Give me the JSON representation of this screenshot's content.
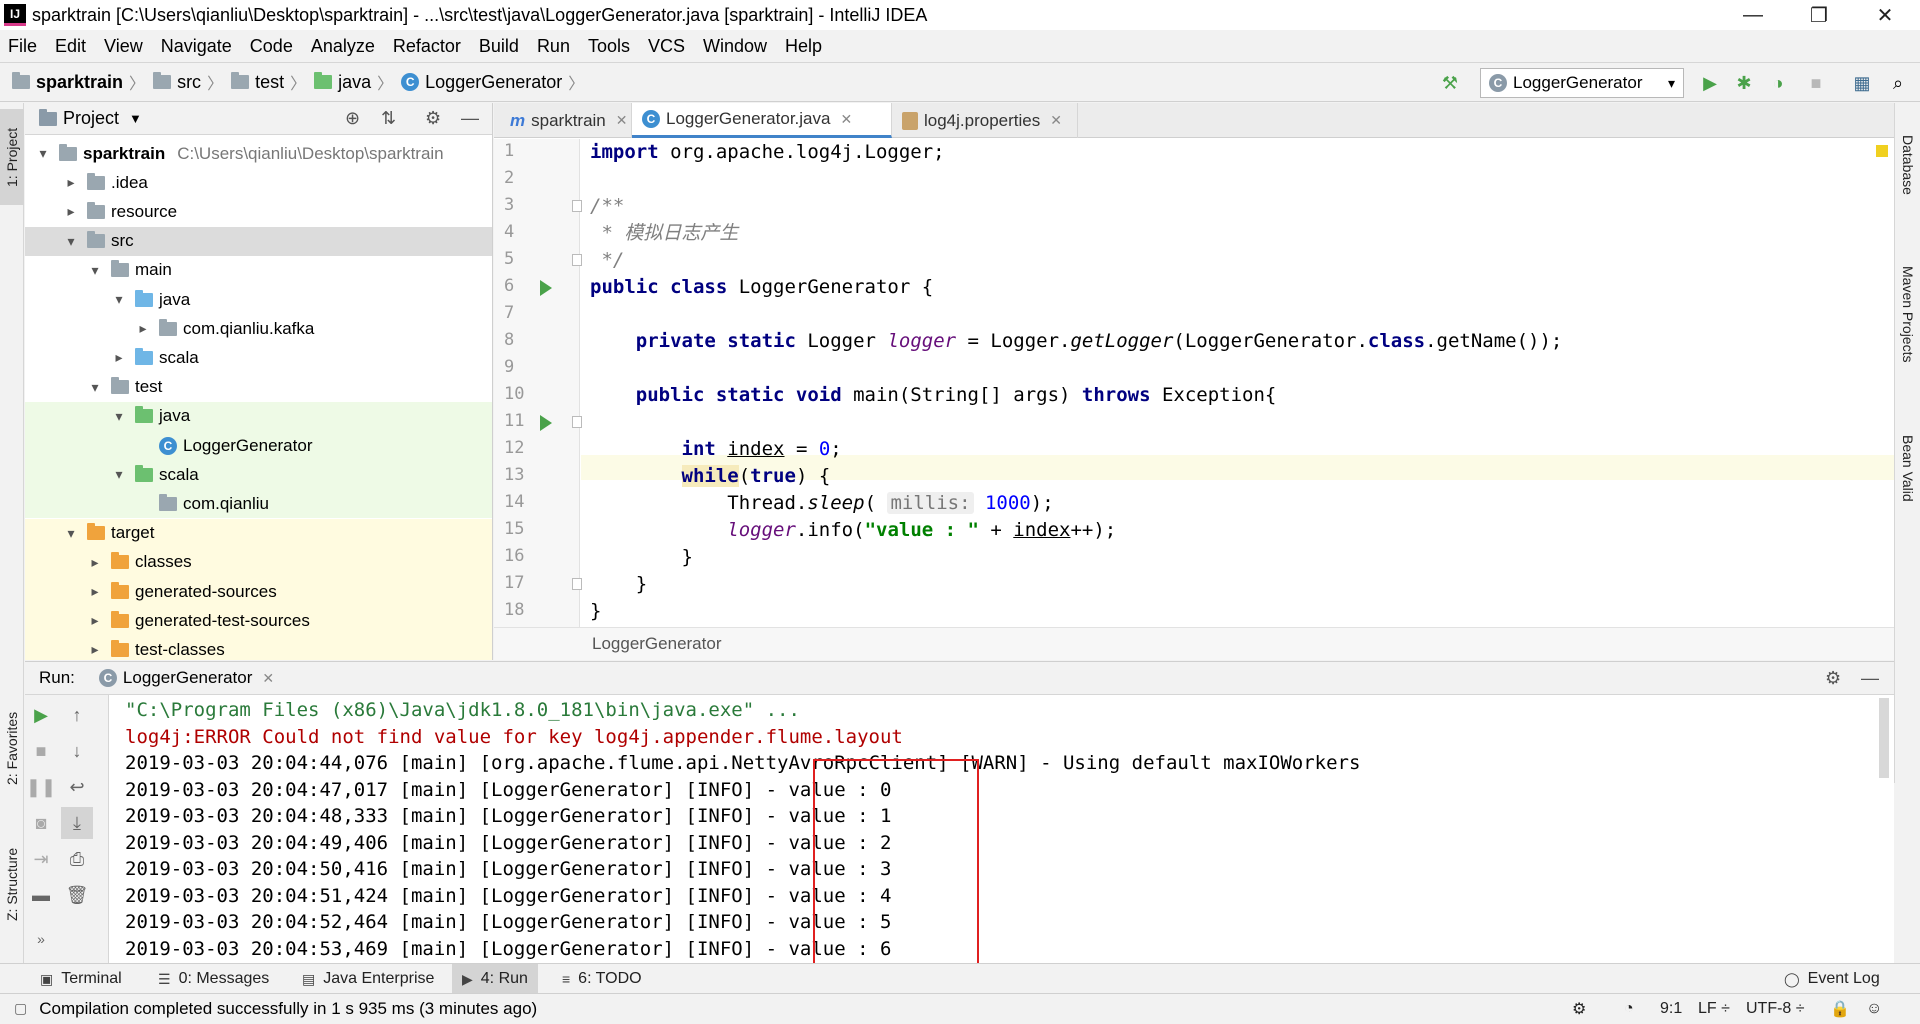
{
  "window": {
    "title": "sparktrain [C:\\Users\\qianliu\\Desktop\\sparktrain] - ...\\src\\test\\java\\LoggerGenerator.java [sparktrain] - IntelliJ IDEA",
    "minimize": "—",
    "maximize": "❐",
    "close": "✕"
  },
  "menu": [
    "File",
    "Edit",
    "View",
    "Navigate",
    "Code",
    "Analyze",
    "Refactor",
    "Build",
    "Run",
    "Tools",
    "VCS",
    "Window",
    "Help"
  ],
  "breadcrumb": [
    "sparktrain",
    "src",
    "test",
    "java",
    "LoggerGenerator"
  ],
  "toolbar": {
    "run_config": "LoggerGenerator",
    "icons": [
      "build-hammer-icon",
      "run-icon",
      "debug-icon",
      "coverage-icon",
      "stop-icon",
      "project-structure-icon",
      "search-icon"
    ]
  },
  "left_strip": {
    "project": "1: Project",
    "favorites": "2: Favorites",
    "structure": "Z: Structure"
  },
  "right_strip": {
    "database": "Database",
    "maven": "Maven Projects",
    "bean": "Bean Valid"
  },
  "project_panel": {
    "title": "Project",
    "tree": [
      {
        "label": "sparktrain",
        "path": "C:\\Users\\qianliu\\Desktop\\sparktrain",
        "arrow": "▾",
        "icon": "module",
        "bold": true
      },
      {
        "label": ".idea",
        "arrow": "▸",
        "icon": "folder"
      },
      {
        "label": "resource",
        "arrow": "▸",
        "icon": "folder"
      },
      {
        "label": "src",
        "arrow": "▾",
        "icon": "folder"
      },
      {
        "label": "main",
        "arrow": "▾",
        "icon": "folder"
      },
      {
        "label": "java",
        "arrow": "▾",
        "icon": "source-folder"
      },
      {
        "label": "com.qianliu.kafka",
        "arrow": "▸",
        "icon": "package"
      },
      {
        "label": "scala",
        "arrow": "▸",
        "icon": "source-folder"
      },
      {
        "label": "test",
        "arrow": "▾",
        "icon": "folder"
      },
      {
        "label": "java",
        "arrow": "▾",
        "icon": "test-folder"
      },
      {
        "label": "LoggerGenerator",
        "arrow": "",
        "icon": "class"
      },
      {
        "label": "scala",
        "arrow": "▾",
        "icon": "test-folder"
      },
      {
        "label": "com.qianliu",
        "arrow": "",
        "icon": "package"
      },
      {
        "label": "target",
        "arrow": "▾",
        "icon": "excluded-folder"
      },
      {
        "label": "classes",
        "arrow": "▸",
        "icon": "excluded-folder"
      },
      {
        "label": "generated-sources",
        "arrow": "▸",
        "icon": "excluded-folder"
      },
      {
        "label": "generated-test-sources",
        "arrow": "▸",
        "icon": "excluded-folder"
      },
      {
        "label": "test-classes",
        "arrow": "▸",
        "icon": "excluded-folder"
      }
    ]
  },
  "editor": {
    "tabs": [
      {
        "label": "sparktrain",
        "icon": "maven-icon"
      },
      {
        "label": "LoggerGenerator.java",
        "icon": "class-icon",
        "active": true
      },
      {
        "label": "log4j.properties",
        "icon": "properties-icon"
      }
    ],
    "line_numbers": [
      "1",
      "2",
      "3",
      "4",
      "5",
      "6",
      "7",
      "8",
      "9",
      "10",
      "11",
      "12",
      "13",
      "14",
      "15",
      "16",
      "17",
      "18"
    ],
    "code": {
      "l1_kw": "import",
      "l1_rest": " org.apache.log4j.Logger;",
      "l3": "/**",
      "l4": " * 模拟日志产生",
      "l5": " */",
      "l6_kw": "public class",
      "l6_rest": " LoggerGenerator {",
      "l8_kw": "private static",
      "l8_a": " Logger ",
      "l8_field": "logger",
      "l8_b": " = Logger.",
      "l8_method": "getLogger",
      "l8_c": "(LoggerGenerator.",
      "l8_kw2": "class",
      "l8_d": ".getName());",
      "l10_kw": "public static void",
      "l10_a": " main(String[] args) ",
      "l10_kw2": "throws",
      "l10_b": " Exception{",
      "l12_kw": "int",
      "l12_var": "index",
      "l12_a": " = ",
      "l12_num": "0",
      "l12_b": ";",
      "l13_kw": "while",
      "l13_a": "(",
      "l13_kw2": "true",
      "l13_b": ") {",
      "l14_a": "Thread.",
      "l14_method": "sleep",
      "l14_b": "( ",
      "l14_hint": "millis:",
      "l14_num": "1000",
      "l14_c": ");",
      "l15_field": "logger",
      "l15_a": ".info(",
      "l15_str": "\"value : \"",
      "l15_b": " + ",
      "l15_var": "index",
      "l15_c": "++);",
      "l16": "}",
      "l17": "}",
      "l18": "}"
    },
    "footer": "LoggerGenerator"
  },
  "run_panel": {
    "label": "Run:",
    "tab": "LoggerGenerator",
    "console": [
      {
        "text": "\"C:\\Program Files (x86)\\Java\\jdk1.8.0_181\\bin\\java.exe\" ...",
        "kind": "cmd"
      },
      {
        "text": "log4j:ERROR Could not find value for key log4j.appender.flume.layout",
        "kind": "err"
      },
      {
        "text": "2019-03-03 20:04:44,076 [main] [org.apache.flume.api.NettyAvroRpcClient] [WARN] - Using default maxIOWorkers",
        "kind": "out"
      },
      {
        "text": "2019-03-03 20:04:47,017 [main] [LoggerGenerator] [INFO] - value : 0",
        "kind": "out"
      },
      {
        "text": "2019-03-03 20:04:48,333 [main] [LoggerGenerator] [INFO] - value : 1",
        "kind": "out"
      },
      {
        "text": "2019-03-03 20:04:49,406 [main] [LoggerGenerator] [INFO] - value : 2",
        "kind": "out"
      },
      {
        "text": "2019-03-03 20:04:50,416 [main] [LoggerGenerator] [INFO] - value : 3",
        "kind": "out"
      },
      {
        "text": "2019-03-03 20:04:51,424 [main] [LoggerGenerator] [INFO] - value : 4",
        "kind": "out"
      },
      {
        "text": "2019-03-03 20:04:52,464 [main] [LoggerGenerator] [INFO] - value : 5",
        "kind": "out"
      },
      {
        "text": "2019-03-03 20:04:53,469 [main] [LoggerGenerator] [INFO] - value : 6",
        "kind": "out"
      }
    ]
  },
  "bottom_tabs": {
    "terminal": "Terminal",
    "messages": "0: Messages",
    "java_enterprise": "Java Enterprise",
    "run": "4: Run",
    "todo": "6: TODO",
    "event_log": "Event Log"
  },
  "status": {
    "message": "Compilation completed successfully in 1 s 935 ms (3 minutes ago)",
    "position": "9:1",
    "line_sep": "LF ÷",
    "encoding": "UTF-8 ÷"
  },
  "colors": {
    "accent": "#4083c9",
    "run_green": "#4aa24a",
    "highlight_red": "#e02020",
    "error_red": "#b00000",
    "string_green": "#008000",
    "keyword_navy": "#000080"
  }
}
